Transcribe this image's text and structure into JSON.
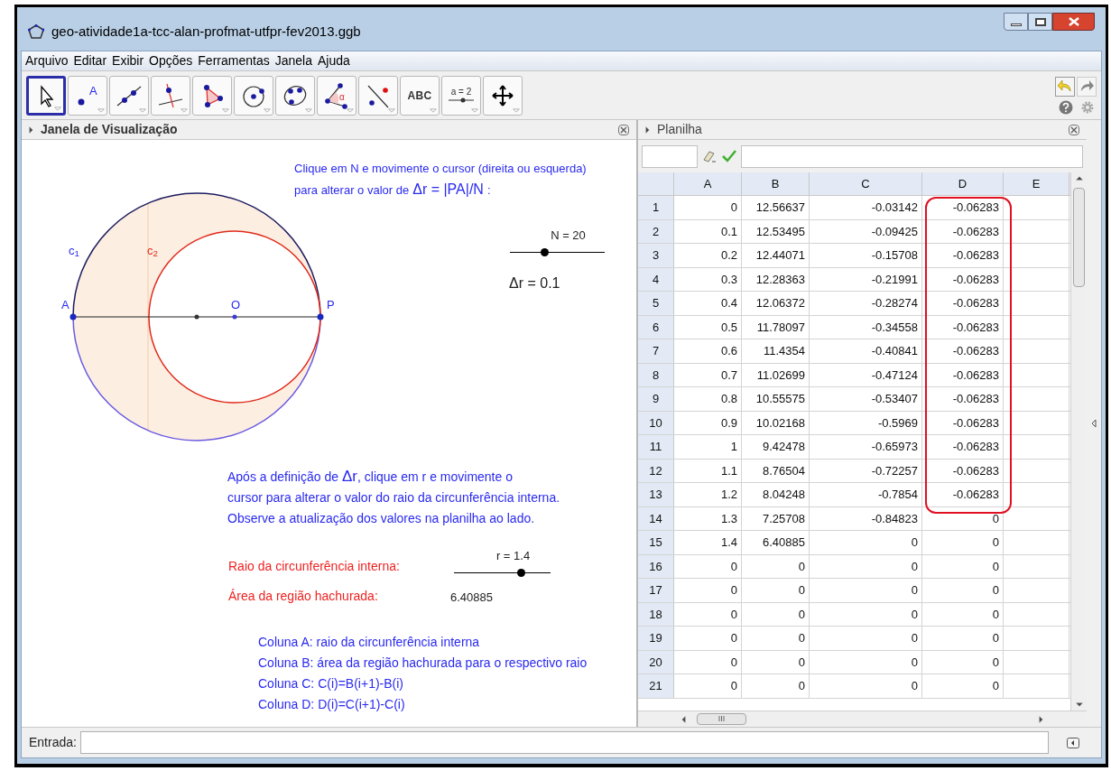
{
  "window": {
    "title": "geo-atividade1a-tcc-alan-profmat-utfpr-fev2013.ggb"
  },
  "menu": [
    "Arquivo",
    "Editar",
    "Exibir",
    "Opções",
    "Ferramentas",
    "Janela",
    "Ajuda"
  ],
  "tools": [
    {
      "kind": "pointer",
      "selected": true
    },
    {
      "kind": "point",
      "label": "A",
      "selected": false
    },
    {
      "kind": "line",
      "selected": false
    },
    {
      "kind": "perpendicular",
      "selected": false
    },
    {
      "kind": "polygon",
      "selected": false
    },
    {
      "kind": "circle",
      "selected": false
    },
    {
      "kind": "conic",
      "selected": false
    },
    {
      "kind": "angle",
      "label": "α",
      "selected": false
    },
    {
      "kind": "reflect",
      "selected": false
    },
    {
      "kind": "text",
      "label": "ABC",
      "selected": false
    },
    {
      "kind": "slider",
      "label": "a = 2",
      "selected": false
    },
    {
      "kind": "move",
      "selected": false
    }
  ],
  "graphics_view": {
    "title": "Janela de Visualização",
    "instruction_1": [
      "Clique em N e movimente o cursor (direita ou esquerda)",
      "para alterar o valor de"
    ],
    "formula_1": "Δr = |PA|/N",
    "formula_1_end": ":",
    "labels": {
      "c1": "c",
      "c1_sub": "1",
      "c2": "c",
      "c2_sub": "2",
      "A": "A",
      "O": "O",
      "P": "P"
    },
    "slider_n": {
      "label": "N = 20",
      "level": 0.36
    },
    "delta_r": "Δr = 0.1",
    "instruction_2": [
      "Após a definição de",
      "Δr",
      ", clique em r e movimente o",
      "cursor para alterar o valor do raio da circunferência interna.",
      "Observe a atualização dos valores na planilha ao lado."
    ],
    "radius_label": "Raio da circunferência interna:",
    "slider_r": {
      "label": "r = 1.4",
      "level": 0.69
    },
    "area_label": "Área da região hachurada:",
    "area_value": "6.40885",
    "legend": [
      "Coluna A: raio da circunferência interna",
      "Coluna B: área da região hachurada para o respectivo raio",
      "Coluna C: C(i)=B(i+1)-B(i)",
      "Coluna D: D(i)=C(i+1)-C(i)"
    ]
  },
  "spreadsheet": {
    "title": "Planilha",
    "columns": [
      "A",
      "B",
      "C",
      "D",
      "E"
    ],
    "rows": [
      {
        "n": "1",
        "cells": [
          "0",
          "12.56637",
          "-0.03142",
          "-0.06283"
        ]
      },
      {
        "n": "2",
        "cells": [
          "0.1",
          "12.53495",
          "-0.09425",
          "-0.06283"
        ]
      },
      {
        "n": "3",
        "cells": [
          "0.2",
          "12.44071",
          "-0.15708",
          "-0.06283"
        ]
      },
      {
        "n": "4",
        "cells": [
          "0.3",
          "12.28363",
          "-0.21991",
          "-0.06283"
        ]
      },
      {
        "n": "5",
        "cells": [
          "0.4",
          "12.06372",
          "-0.28274",
          "-0.06283"
        ]
      },
      {
        "n": "6",
        "cells": [
          "0.5",
          "11.78097",
          "-0.34558",
          "-0.06283"
        ]
      },
      {
        "n": "7",
        "cells": [
          "0.6",
          "11.4354",
          "-0.40841",
          "-0.06283"
        ]
      },
      {
        "n": "8",
        "cells": [
          "0.7",
          "11.02699",
          "-0.47124",
          "-0.06283"
        ]
      },
      {
        "n": "9",
        "cells": [
          "0.8",
          "10.55575",
          "-0.53407",
          "-0.06283"
        ]
      },
      {
        "n": "10",
        "cells": [
          "0.9",
          "10.02168",
          "-0.5969",
          "-0.06283"
        ]
      },
      {
        "n": "11",
        "cells": [
          "1",
          "9.42478",
          "-0.65973",
          "-0.06283"
        ]
      },
      {
        "n": "12",
        "cells": [
          "1.1",
          "8.76504",
          "-0.72257",
          "-0.06283"
        ]
      },
      {
        "n": "13",
        "cells": [
          "1.2",
          "8.04248",
          "-0.7854",
          "-0.06283"
        ]
      },
      {
        "n": "14",
        "cells": [
          "1.3",
          "7.25708",
          "-0.84823",
          "0"
        ]
      },
      {
        "n": "15",
        "cells": [
          "1.4",
          "6.40885",
          "0",
          "0"
        ]
      },
      {
        "n": "16",
        "cells": [
          "0",
          "0",
          "0",
          "0"
        ]
      },
      {
        "n": "17",
        "cells": [
          "0",
          "0",
          "0",
          "0"
        ]
      },
      {
        "n": "18",
        "cells": [
          "0",
          "0",
          "0",
          "0"
        ]
      },
      {
        "n": "19",
        "cells": [
          "0",
          "0",
          "0",
          "0"
        ]
      },
      {
        "n": "20",
        "cells": [
          "0",
          "0",
          "0",
          "0"
        ]
      },
      {
        "n": "21",
        "cells": [
          "0",
          "0",
          "0",
          "0"
        ]
      }
    ],
    "scroll_label": "III"
  },
  "input_bar": {
    "label": "Entrada:"
  }
}
